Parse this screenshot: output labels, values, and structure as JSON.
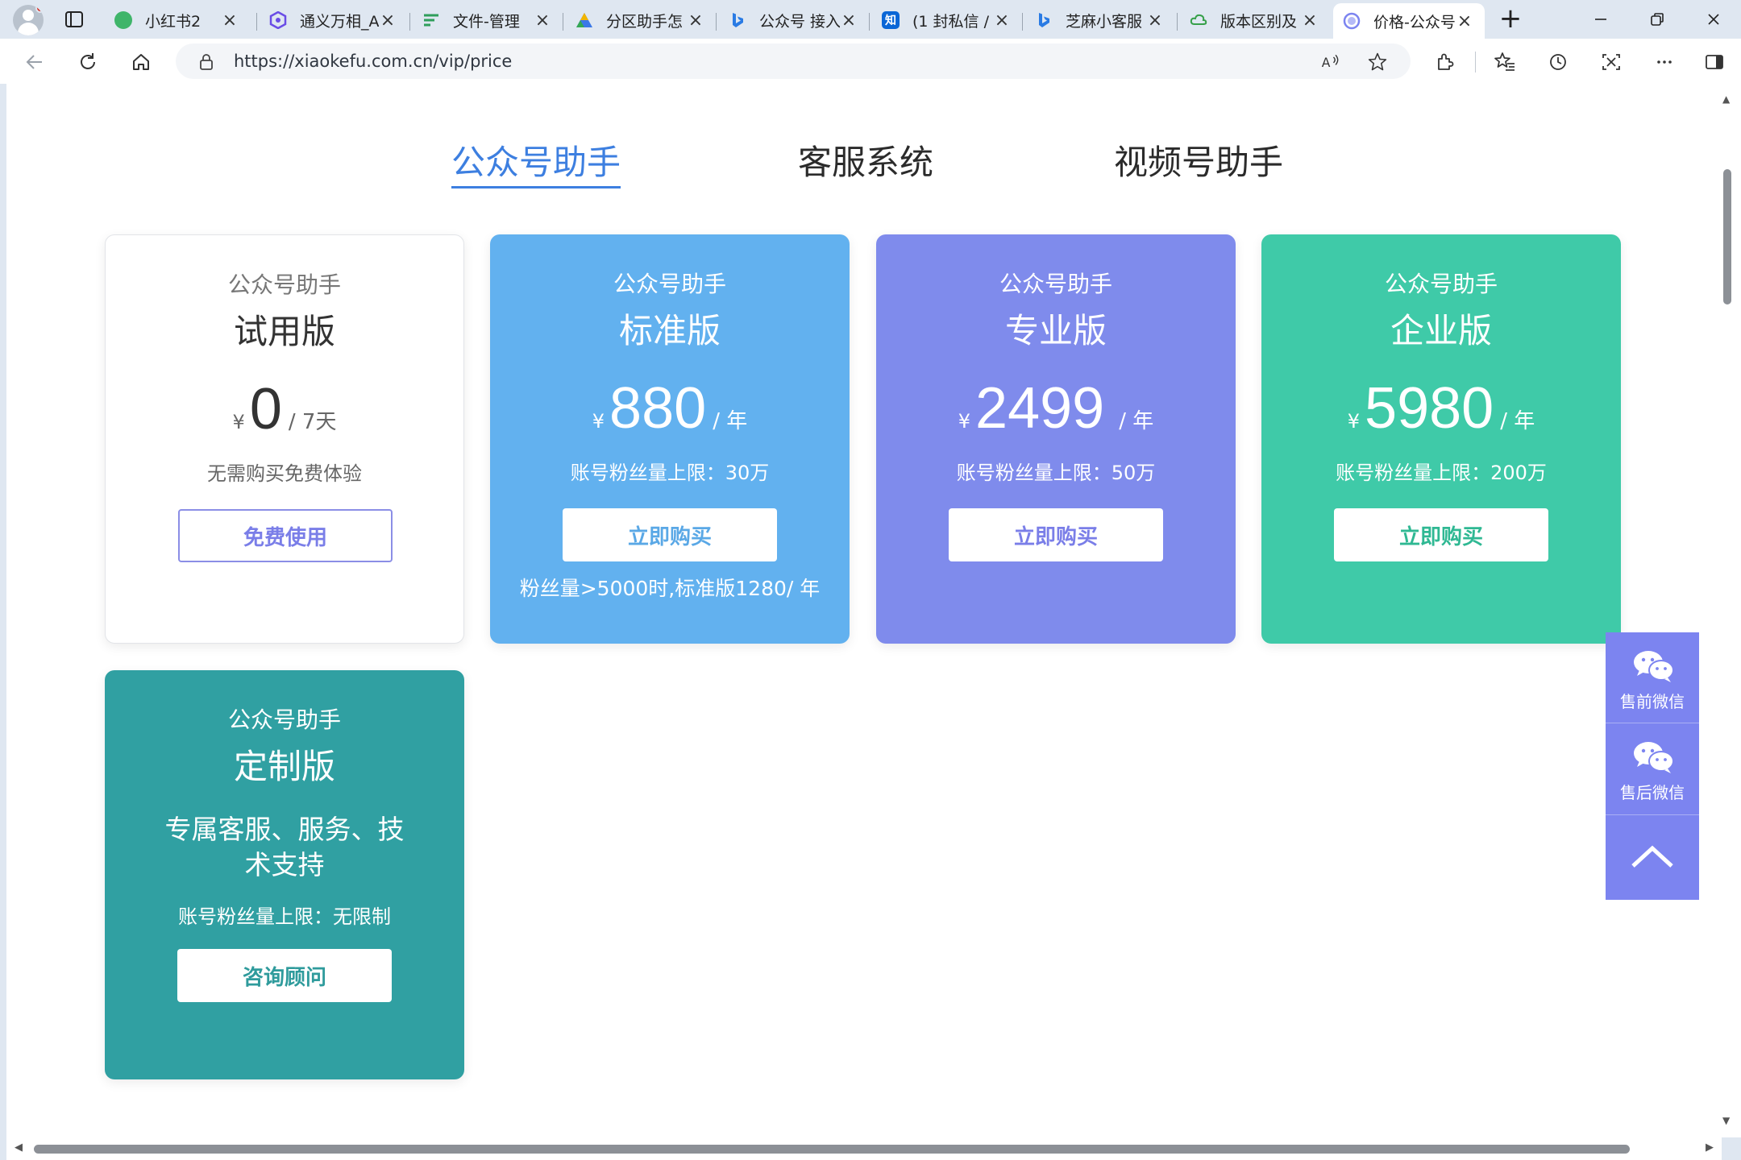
{
  "browser": {
    "tabs": [
      {
        "title": "小红书2",
        "favicon": "xiaohongshu-icon",
        "color": "#3fb56a"
      },
      {
        "title": "通义万相_A",
        "favicon": "tongyi-icon",
        "color": "#6a4de6"
      },
      {
        "title": "文件-管理",
        "favicon": "doc-lines-icon",
        "color": "#2f9e5b"
      },
      {
        "title": "分区助手怎",
        "favicon": "triangle-icon",
        "color": "#3b78e7"
      },
      {
        "title": "公众号 接入",
        "favicon": "bing-icon",
        "color": "#2a7be4"
      },
      {
        "title": "(1 封私信 /",
        "favicon": "zhihu-icon",
        "color": "#0a66d6"
      },
      {
        "title": "芝麻小客服",
        "favicon": "bing-icon",
        "color": "#2a7be4"
      },
      {
        "title": "版本区别及",
        "favicon": "cloud-icon",
        "color": "#37a04a"
      },
      {
        "title": "价格-公众号",
        "favicon": "page-circle-icon",
        "color": "#7c84f0",
        "active": true
      }
    ],
    "zhihu_glyph": "知",
    "url": "https://xiaokefu.com.cn/vip/price"
  },
  "nav": {
    "tabs": [
      "公众号助手",
      "客服系统",
      "视频号助手"
    ],
    "active_index": 0
  },
  "plans": [
    {
      "product": "公众号助手",
      "name": "试用版",
      "currency": "¥",
      "price": "0",
      "period": "/ 7天",
      "limit": "无需购买免费体验",
      "button": "免费使用",
      "color": "#ffffff",
      "style": "outline"
    },
    {
      "product": "公众号助手",
      "name": "标准版",
      "currency": "¥",
      "price": "880",
      "period": "/ 年",
      "limit": "账号粉丝量上限：30万",
      "button": "立即购买",
      "note": "粉丝量>5000时,标准版1280/ 年",
      "color": "#62b1ef",
      "button_color": "#5aa8e6"
    },
    {
      "product": "公众号助手",
      "name": "专业版",
      "currency": "¥",
      "price": "2499",
      "period": "/ 年",
      "limit": "账号粉丝量上限：50万",
      "button": "立即购买",
      "color": "#7f8bec",
      "button_color": "#7a7ee8"
    },
    {
      "product": "公众号助手",
      "name": "企业版",
      "currency": "¥",
      "price": "5980",
      "period": "/ 年",
      "limit": "账号粉丝量上限：200万",
      "button": "立即购买",
      "color": "#3fcaa8",
      "button_color": "#2fb893"
    },
    {
      "product": "公众号助手",
      "name": "定制版",
      "description": "专属客服、服务、技术支持",
      "limit": "账号粉丝量上限：无限制",
      "button": "咨询顾问",
      "color": "#30a0a2",
      "button_color": "#2f9b9c"
    }
  ],
  "side_panel": {
    "items": [
      {
        "label": "售前微信",
        "icon": "wechat-icon"
      },
      {
        "label": "售后微信",
        "icon": "wechat-icon"
      }
    ],
    "back_to_top_icon": "chevron-up-icon",
    "color": "#7c84f0"
  }
}
